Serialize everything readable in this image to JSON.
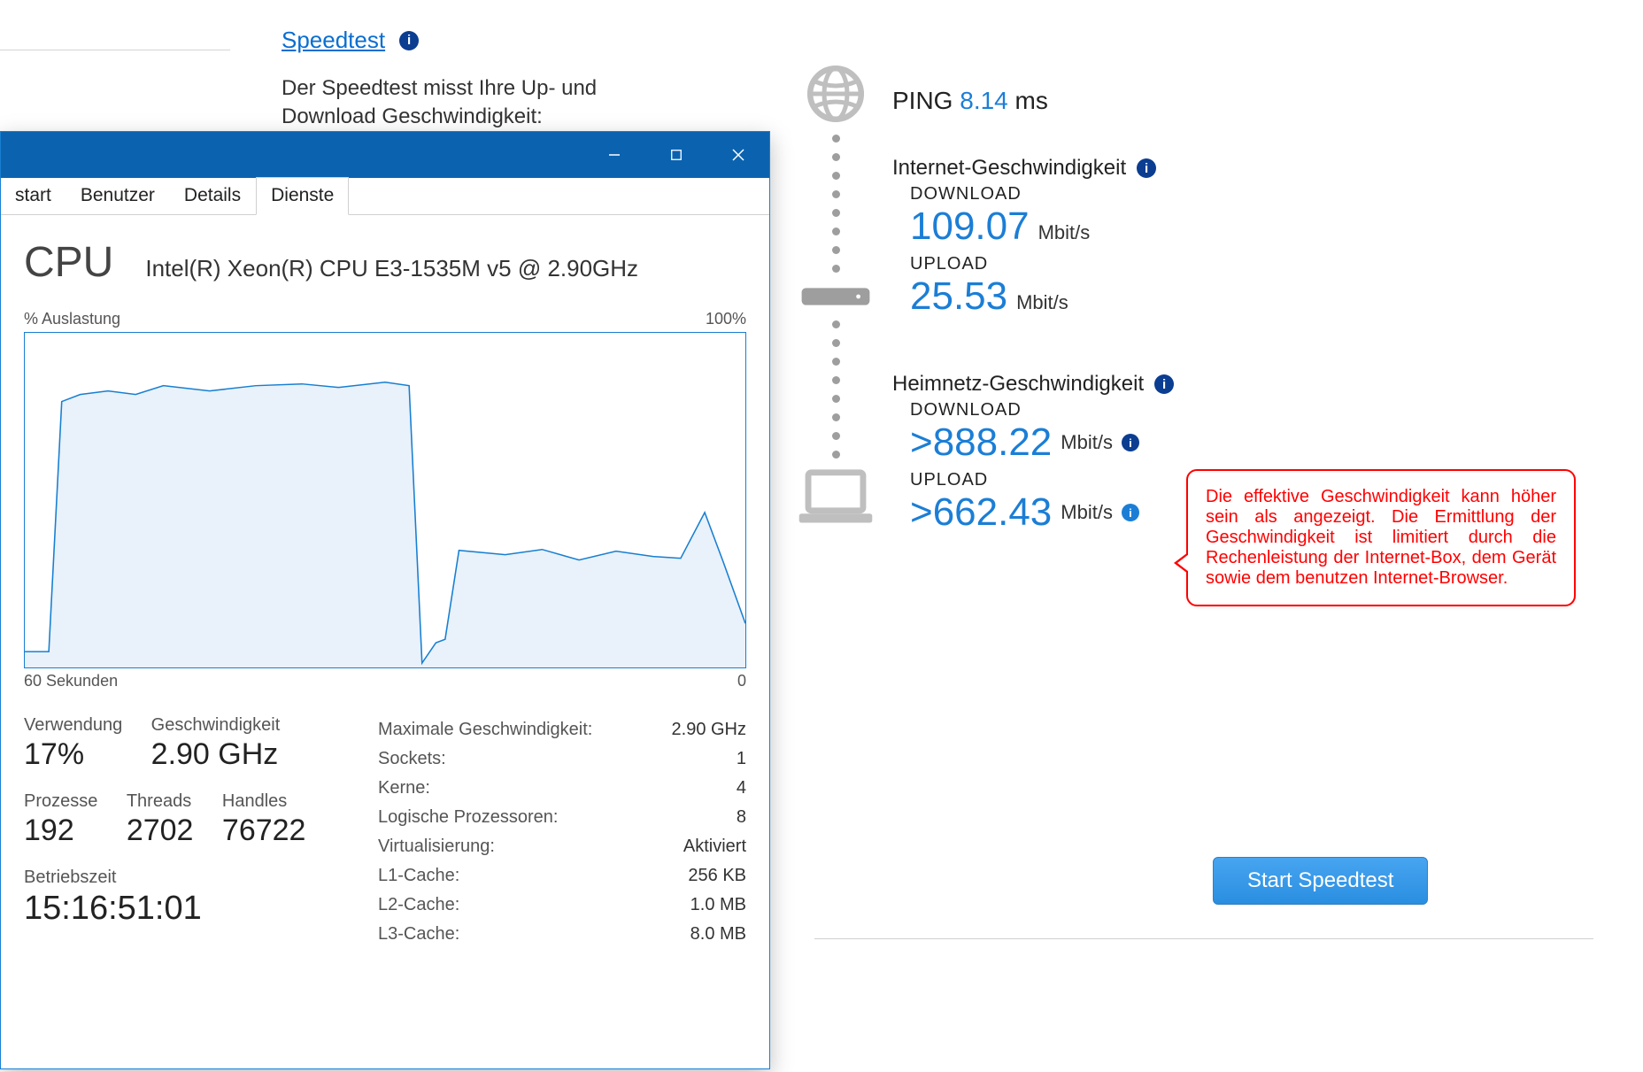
{
  "speedtest": {
    "title": "Speedtest",
    "description": "Der Speedtest misst Ihre Up- und Download Geschwindigkeit:",
    "ping_label": "PING",
    "ping_value": "8.14",
    "ping_unit": "ms",
    "internet": {
      "title": "Internet-Geschwindigkeit",
      "download_label": "DOWNLOAD",
      "download_value": "109.07",
      "download_unit": "Mbit/s",
      "upload_label": "UPLOAD",
      "upload_value": "25.53",
      "upload_unit": "Mbit/s"
    },
    "home": {
      "title": "Heimnetz-Geschwindigkeit",
      "download_label": "DOWNLOAD",
      "download_value": ">888.22",
      "download_unit": "Mbit/s",
      "upload_label": "UPLOAD",
      "upload_value": ">662.43",
      "upload_unit": "Mbit/s"
    },
    "callout": "Die effektive Geschwindigkeit kann höher sein als angezeigt. Die Ermittlung der Geschwindigkeit ist limitiert durch die Rechenleistung der Internet-Box, dem Gerät sowie dem benutzen Internet-Browser.",
    "start_button": "Start Speedtest"
  },
  "taskmgr": {
    "tabs": {
      "start": "start",
      "benutzer": "Benutzer",
      "details": "Details",
      "dienste": "Dienste"
    },
    "cpu_title": "CPU",
    "cpu_model": "Intel(R) Xeon(R) CPU E3-1535M v5 @ 2.90GHz",
    "chart": {
      "top_left": "% Auslastung",
      "top_right": "100%",
      "bottom_left": "60 Sekunden",
      "bottom_right": "0"
    },
    "stats_left": {
      "verwendung_label": "Verwendung",
      "verwendung_value": "17%",
      "geschwindigkeit_label": "Geschwindigkeit",
      "geschwindigkeit_value": "2.90 GHz",
      "prozesse_label": "Prozesse",
      "prozesse_value": "192",
      "threads_label": "Threads",
      "threads_value": "2702",
      "handles_label": "Handles",
      "handles_value": "76722",
      "betriebszeit_label": "Betriebszeit",
      "betriebszeit_value": "15:16:51:01"
    },
    "stats_right": {
      "maxspeed_label": "Maximale Geschwindigkeit:",
      "maxspeed_value": "2.90 GHz",
      "sockets_label": "Sockets:",
      "sockets_value": "1",
      "kerne_label": "Kerne:",
      "kerne_value": "4",
      "logproc_label": "Logische Prozessoren:",
      "logproc_value": "8",
      "virt_label": "Virtualisierung:",
      "virt_value": "Aktiviert",
      "l1_label": "L1-Cache:",
      "l1_value": "256 KB",
      "l2_label": "L2-Cache:",
      "l2_value": "1.0 MB",
      "l3_label": "L3-Cache:",
      "l3_value": "8.0 MB"
    }
  },
  "chart_data": {
    "type": "line",
    "title": "% Auslastung",
    "xlabel": "Sekunden",
    "ylabel": "%",
    "xlim": [
      0,
      60
    ],
    "ylim": [
      0,
      100
    ],
    "x": [
      60,
      58,
      56,
      54,
      52,
      50,
      48,
      46,
      44,
      42,
      40,
      38,
      36,
      34,
      32,
      30,
      28,
      26,
      24,
      22,
      20,
      18,
      16,
      14,
      12,
      10,
      8,
      6,
      4,
      2,
      0
    ],
    "values": [
      5,
      5,
      80,
      83,
      84,
      85,
      84,
      86,
      84,
      85,
      84,
      86,
      84,
      85,
      86,
      85,
      6,
      8,
      10,
      35,
      35,
      33,
      34,
      36,
      34,
      35,
      33,
      35,
      48,
      32,
      20
    ]
  }
}
